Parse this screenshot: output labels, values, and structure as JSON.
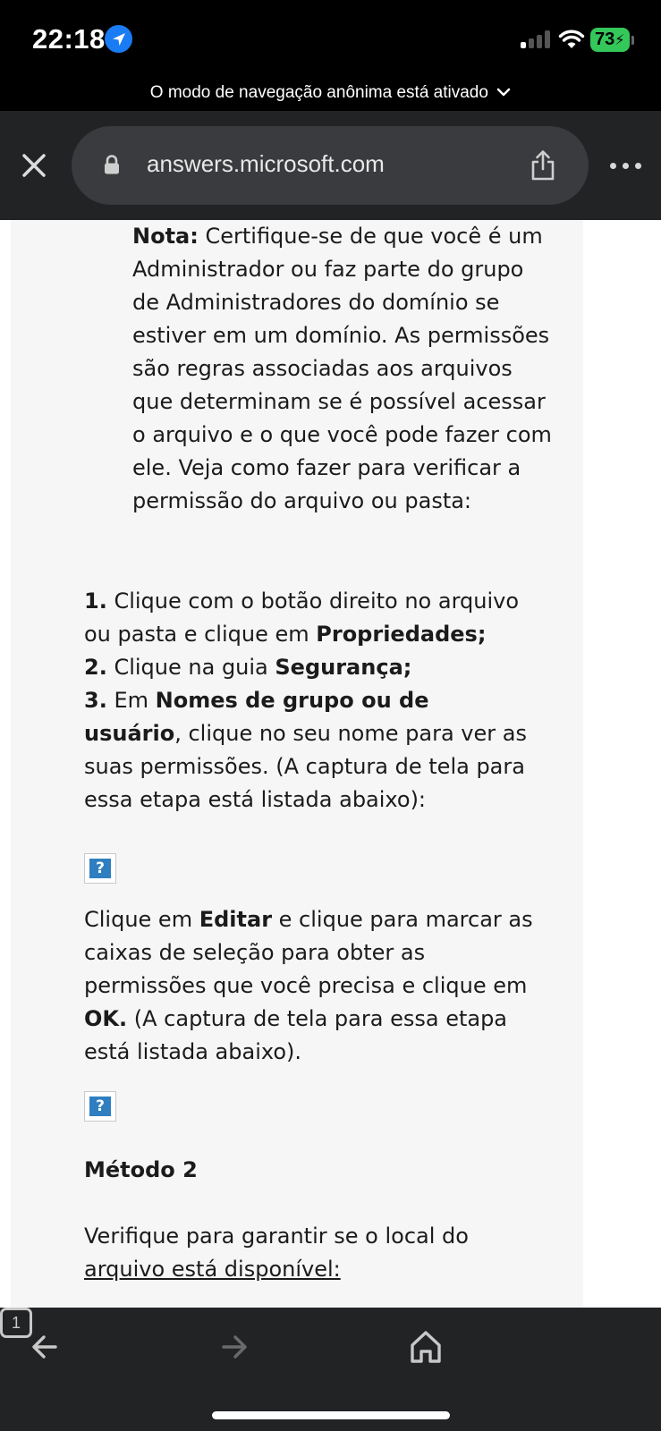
{
  "status_bar": {
    "time": "22:18",
    "battery_level": "73",
    "icons": [
      "location-arrow-icon",
      "cellular-signal-icon",
      "wifi-icon",
      "battery-charging-icon"
    ]
  },
  "incognito_banner": {
    "text": "O modo de navegação anônima está ativado"
  },
  "toolbar": {
    "url": "answers.microsoft.com",
    "icons": [
      "close-icon",
      "lock-icon",
      "share-icon",
      "more-icon"
    ]
  },
  "article": {
    "note_label": "Nota:",
    "note_body": " Certifique-se de que você é um Administrador ou faz parte do grupo de Administradores do domínio se estiver em um domínio. As permissões são regras associadas aos arquivos que determinam se é possível acessar o arquivo e o que você pode fazer com ele. Veja como fazer para verificar a permissão do arquivo ou pasta:",
    "step1_num": "1.",
    "step1_text": " Clique com o botão direito no arquivo ou pasta e clique em ",
    "step1_bold": "Propriedades;",
    "step2_num": "2.",
    "step2_text": " Clique na guia ",
    "step2_bold": "Segurança;",
    "step3_num": "3.",
    "step3_text": " Em ",
    "step3_bold": "Nomes de grupo ou de usuário",
    "step3_rest": ", clique no seu nome para ver as suas permissões. (A captura de tela para essa etapa está listada abaixo):",
    "image_placeholder": "?",
    "edit_pre": "Clique em ",
    "edit_bold": "Editar",
    "edit_mid": " e clique para marcar as caixas de seleção para obter as permissões que você precisa e clique em ",
    "edit_ok": "OK.",
    "edit_post": " (A captura de tela para essa etapa está listada abaixo).",
    "method_heading": "Método 2",
    "verify_text_1": "Verifique para garantir se o local do ",
    "verify_text_2": "arquivo está disponível:"
  },
  "bottom_bar": {
    "tab_count": "1",
    "icons": [
      "back-arrow-icon",
      "forward-arrow-icon",
      "home-icon",
      "tabs-icon"
    ]
  }
}
